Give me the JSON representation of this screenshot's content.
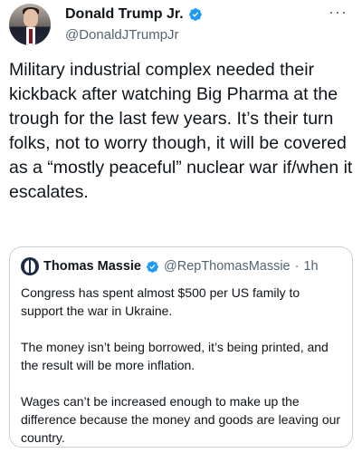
{
  "tweet": {
    "author": {
      "display_name": "Donald Trump Jr.",
      "handle": "@DonaldJTrumpJr",
      "verified_icon": "verified-badge-icon",
      "avatar": "profile-photo"
    },
    "more_label": "···",
    "text": "Military industrial complex needed their kickback after watching Big Pharma at the trough for the last few years. It’s their turn folks, not to worry though, it will be covered as a “mostly peaceful” nuclear war if/when it escalates."
  },
  "quote": {
    "author": {
      "display_name": "Thomas Massie",
      "handle": "@RepThomasMassie",
      "separator": "·",
      "time": "1h",
      "verified_icon": "verified-badge-icon"
    },
    "paragraphs": [
      "Congress has spent almost $500 per US family to support the war in Ukraine.",
      "The money isn’t being borrowed, it’s being printed, and the result will be more inflation.",
      "Wages can’t be increased enough to make up the difference because the money and goods are leaving our country."
    ]
  },
  "colors": {
    "text": "#0f1419",
    "secondary": "#536471",
    "verified": "#1d9bf0",
    "border": "#c9d1d7"
  }
}
